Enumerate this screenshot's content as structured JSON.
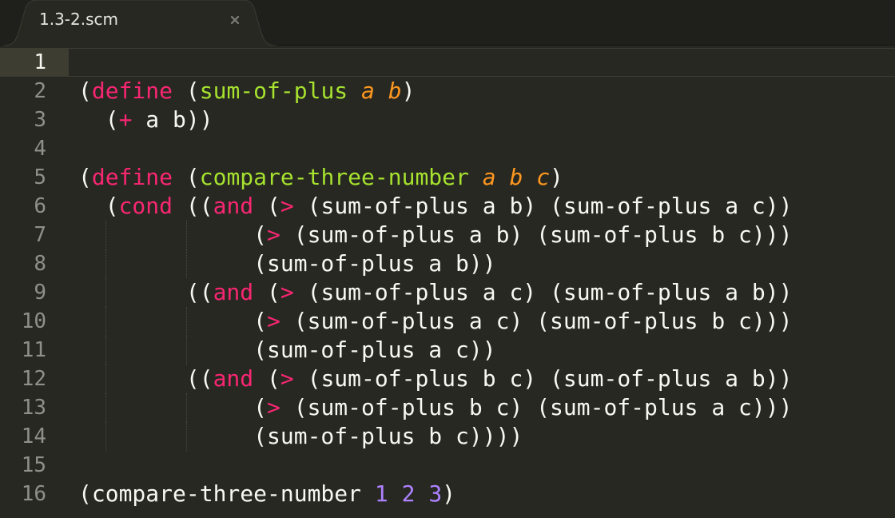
{
  "tab": {
    "title": "1.3-2.scm",
    "close_glyph": "×"
  },
  "colors": {
    "background": "#272822",
    "keyword": "#f92672",
    "function_name": "#a6e22e",
    "parameter": "#fd971f",
    "number": "#ae81ff",
    "text": "#f8f8f2",
    "line_number": "#8f908a"
  },
  "editor": {
    "current_line": 1,
    "line_numbers": [
      "1",
      "2",
      "3",
      "4",
      "5",
      "6",
      "7",
      "8",
      "9",
      "10",
      "11",
      "12",
      "13",
      "14",
      "15",
      "16"
    ],
    "lines": [
      [],
      [
        {
          "t": "(",
          "c": "plain"
        },
        {
          "t": "define",
          "c": "kw"
        },
        {
          "t": " (",
          "c": "plain"
        },
        {
          "t": "sum-of-plus",
          "c": "fn"
        },
        {
          "t": " ",
          "c": "plain"
        },
        {
          "t": "a",
          "c": "param"
        },
        {
          "t": " ",
          "c": "plain"
        },
        {
          "t": "b",
          "c": "param"
        },
        {
          "t": ")",
          "c": "plain"
        }
      ],
      [
        {
          "t": "  (",
          "c": "plain"
        },
        {
          "t": "+",
          "c": "kw"
        },
        {
          "t": " a b))",
          "c": "plain"
        }
      ],
      [],
      [
        {
          "t": "(",
          "c": "plain"
        },
        {
          "t": "define",
          "c": "kw"
        },
        {
          "t": " (",
          "c": "plain"
        },
        {
          "t": "compare-three-number",
          "c": "fn"
        },
        {
          "t": " ",
          "c": "plain"
        },
        {
          "t": "a",
          "c": "param"
        },
        {
          "t": " ",
          "c": "plain"
        },
        {
          "t": "b",
          "c": "param"
        },
        {
          "t": " ",
          "c": "plain"
        },
        {
          "t": "c",
          "c": "param"
        },
        {
          "t": ")",
          "c": "plain"
        }
      ],
      [
        {
          "t": "  (",
          "c": "plain"
        },
        {
          "t": "cond",
          "c": "kw"
        },
        {
          "t": " ((",
          "c": "plain"
        },
        {
          "t": "and",
          "c": "kw"
        },
        {
          "t": " (",
          "c": "plain"
        },
        {
          "t": ">",
          "c": "kw"
        },
        {
          "t": " (sum-of-plus a b) (sum-of-plus a c))",
          "c": "plain"
        }
      ],
      [
        {
          "t": "             (",
          "c": "plain"
        },
        {
          "t": ">",
          "c": "kw"
        },
        {
          "t": " (sum-of-plus a b) (sum-of-plus b c)))",
          "c": "plain"
        }
      ],
      [
        {
          "t": "             (sum-of-plus a b))",
          "c": "plain"
        }
      ],
      [
        {
          "t": "        ((",
          "c": "plain"
        },
        {
          "t": "and",
          "c": "kw"
        },
        {
          "t": " (",
          "c": "plain"
        },
        {
          "t": ">",
          "c": "kw"
        },
        {
          "t": " (sum-of-plus a c) (sum-of-plus a b))",
          "c": "plain"
        }
      ],
      [
        {
          "t": "             (",
          "c": "plain"
        },
        {
          "t": ">",
          "c": "kw"
        },
        {
          "t": " (sum-of-plus a c) (sum-of-plus b c)))",
          "c": "plain"
        }
      ],
      [
        {
          "t": "             (sum-of-plus a c))",
          "c": "plain"
        }
      ],
      [
        {
          "t": "        ((",
          "c": "plain"
        },
        {
          "t": "and",
          "c": "kw"
        },
        {
          "t": " (",
          "c": "plain"
        },
        {
          "t": ">",
          "c": "kw"
        },
        {
          "t": " (sum-of-plus b c) (sum-of-plus a b))",
          "c": "plain"
        }
      ],
      [
        {
          "t": "             (",
          "c": "plain"
        },
        {
          "t": ">",
          "c": "kw"
        },
        {
          "t": " (sum-of-plus b c) (sum-of-plus a c)))",
          "c": "plain"
        }
      ],
      [
        {
          "t": "             (sum-of-plus b c))))",
          "c": "plain"
        }
      ],
      [],
      [
        {
          "t": "(compare-three-number ",
          "c": "plain"
        },
        {
          "t": "1",
          "c": "num"
        },
        {
          "t": " ",
          "c": "plain"
        },
        {
          "t": "2",
          "c": "num"
        },
        {
          "t": " ",
          "c": "plain"
        },
        {
          "t": "3",
          "c": "num"
        },
        {
          "t": ")",
          "c": "plain"
        }
      ]
    ]
  }
}
